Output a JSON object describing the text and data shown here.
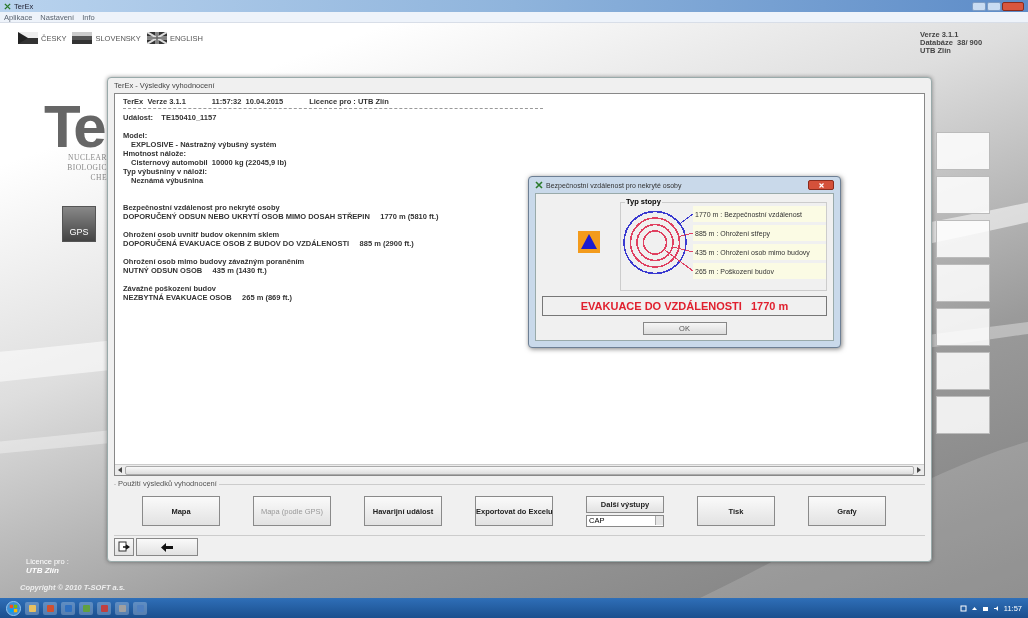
{
  "app_window": {
    "title": "TerEx"
  },
  "menu": [
    "Aplikace",
    "Nastavení",
    "Info"
  ],
  "languages": [
    {
      "label": "ČESKY",
      "kind": "czech"
    },
    {
      "label": "SLOVENSKY",
      "kind": "slovak"
    },
    {
      "label": "ENGLISH",
      "kind": "british"
    }
  ],
  "version_info": [
    "Verze 3.1.1",
    "Databáze  38/ 900",
    "UTB Zlín"
  ],
  "logo": {
    "text": "Te",
    "lines": [
      "NUCLEAR",
      "BIOLOGIC",
      "CHE"
    ]
  },
  "gps_button": "GPS",
  "licence": {
    "label": "Licence pro :",
    "name": "UTB Zlín",
    "copyright": "Copyright © 2010 T-SOFT a.s."
  },
  "results_window": {
    "title": "TerEx - Výsledky vyhodnocení",
    "header": [
      "TerEx  Verze 3.1.1",
      "11:57:32  10.04.2015",
      "Licence pro : UTB Zlín"
    ],
    "report": [
      {
        "kind": "line",
        "text": "Událost:    TE150410_1157"
      },
      {
        "kind": "gap"
      },
      {
        "kind": "line",
        "text": "Model:"
      },
      {
        "kind": "indent",
        "text": "EXPLOSIVE - Nástražný výbušný systém"
      },
      {
        "kind": "line",
        "text": "Hmotnost nálože:"
      },
      {
        "kind": "indent",
        "text": "Cisternový automobil  10000 kg (22045,9 lb)"
      },
      {
        "kind": "line",
        "text": "Typ výbušniny v náloži:"
      },
      {
        "kind": "indent",
        "text": "Neznámá výbušnina"
      },
      {
        "kind": "gap"
      },
      {
        "kind": "gap"
      },
      {
        "kind": "line",
        "text": "Bezpečnostní vzdálenost pro nekryté osoby"
      },
      {
        "kind": "line",
        "text": "DOPORUČENÝ ODSUN NEBO UKRYTÍ OSOB MIMO DOSAH STŘEPIN     1770 m (5810 ft.)"
      },
      {
        "kind": "gap"
      },
      {
        "kind": "line",
        "text": "Ohrožení osob uvnitř budov okenním sklem"
      },
      {
        "kind": "line",
        "text": "DOPORUČENÁ EVAKUACE OSOB Z BUDOV DO VZDÁLENOSTI     885 m (2900 ft.)"
      },
      {
        "kind": "gap"
      },
      {
        "kind": "line",
        "text": "Ohrožení osob mimo budovy závažným poraněním"
      },
      {
        "kind": "line",
        "text": "NUTNÝ ODSUN OSOB     435 m (1430 ft.)"
      },
      {
        "kind": "gap"
      },
      {
        "kind": "line",
        "text": "Závažné poškození budov"
      },
      {
        "kind": "line",
        "text": "NEZBYTNÁ EVAKUACE OSOB     265 m (869 ft.)"
      }
    ],
    "group_title": "Použití výsledků vyhodnocení",
    "buttons": [
      {
        "kind": "button",
        "label": "Mapa",
        "disabled": false
      },
      {
        "kind": "button",
        "label": "Mapa (podle GPS)",
        "disabled": true
      },
      {
        "kind": "button",
        "label": "Havarijní událost",
        "disabled": false
      },
      {
        "kind": "button",
        "label": "Exportovat do Excelu",
        "disabled": false
      },
      {
        "kind": "combo",
        "label": "Další výstupy",
        "value": "CAP",
        "disabled": false
      },
      {
        "kind": "button",
        "label": "Tisk",
        "disabled": false
      },
      {
        "kind": "button",
        "label": "Grafy",
        "disabled": false
      }
    ]
  },
  "dialog": {
    "title": "Bezpečnostní vzdálenost pro nekryté osoby",
    "legend_title": "Typ stopy",
    "rings": [
      {
        "label": "1770 m : Bezpečnostní vzdálenost",
        "color": "#3a3ad0"
      },
      {
        "label": "885 m : Ohrožení střepy",
        "color": "#e04060"
      },
      {
        "label": "435 m : Ohrožení osob mimo budovy",
        "color": "#e04060"
      },
      {
        "label": "265 m : Poškození budov",
        "color": "#e04060"
      }
    ],
    "message": "EVAKUACE DO VZDÁLENOSTI   1770 m",
    "ok": "OK"
  },
  "clock": "11:57"
}
